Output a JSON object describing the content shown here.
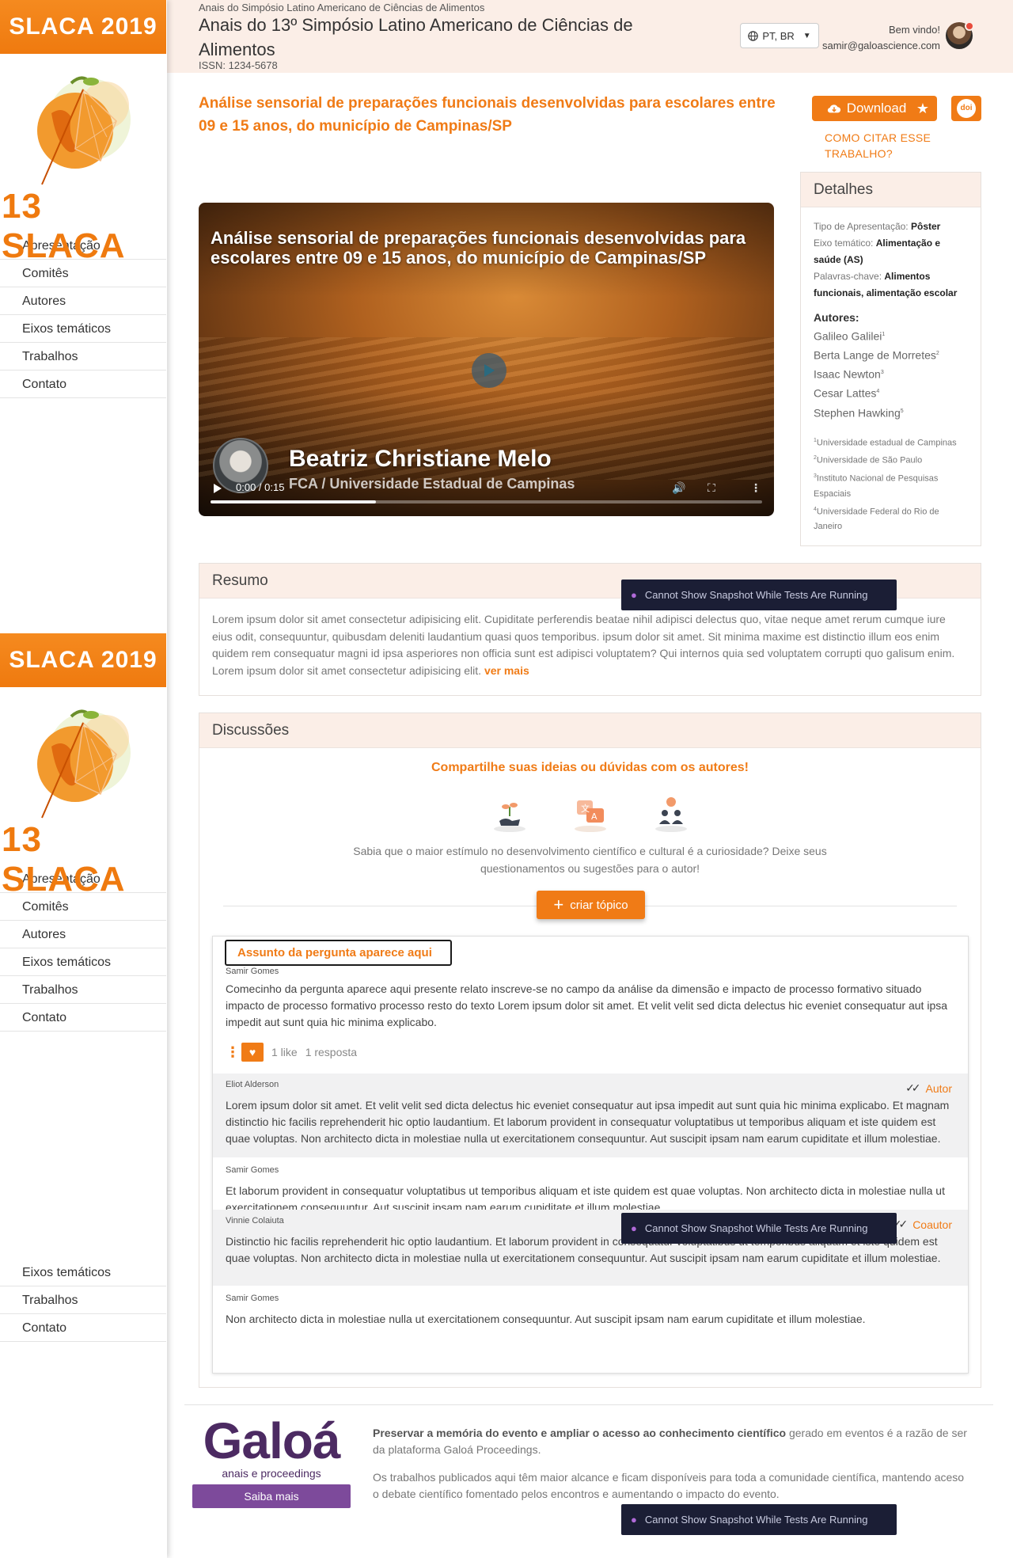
{
  "sidebar": {
    "banner": "SLACA 2019",
    "logo_text": "13 SLACA",
    "items": [
      "Apresentação",
      "Comitês",
      "Autores",
      "Eixos temáticos",
      "Trabalhos",
      "Contato"
    ],
    "partial_items": [
      "Eixos temáticos",
      "Trabalhos",
      "Contato"
    ]
  },
  "header": {
    "crumb": "Anais do Simpósio Latino Americano de Ciências de Alimentos",
    "title": "Anais do 13º Simpósio Latino Americano de Ciências de Alimentos",
    "issn": "ISSN: 1234-5678",
    "language": "PT, BR",
    "welcome": "Bem vindo!",
    "email": "samir@galoascience.com"
  },
  "paper": {
    "title": "Análise sensorial de preparações funcionais desenvolvidas para escolares entre 09 e 15 anos, do município de Campinas/SP",
    "download_label": "Download",
    "doi_label": "doi",
    "cite_label": "COMO CITAR ESSE TRABALHO?"
  },
  "details": {
    "heading": "Detalhes",
    "tipo_key": "Tipo de Apresentação: ",
    "tipo_val": "Pôster",
    "eixo_key": "Eixo temático: ",
    "eixo_val": "Alimentação e saúde (AS)",
    "palavras_key": "Palavras-chave: ",
    "palavras_val": "Alimentos funcionais, alimentação escolar",
    "authors_heading": "Autores:",
    "authors": [
      {
        "name": "Galileo Galilei",
        "sup": "1"
      },
      {
        "name": "Berta Lange de Morretes",
        "sup": "2"
      },
      {
        "name": "Isaac Newton",
        "sup": "3"
      },
      {
        "name": "Cesar Lattes",
        "sup": "4"
      },
      {
        "name": "Stephen Hawking",
        "sup": "5"
      }
    ],
    "affiliations": [
      {
        "sup": "1",
        "name": "Universidade estadual de Campinas"
      },
      {
        "sup": "2",
        "name": "Universidade de São Paulo"
      },
      {
        "sup": "3",
        "name": "Instituto Nacional de Pesquisas Espaciais"
      },
      {
        "sup": "4",
        "name": "Universidade Federal do Rio de Janeiro"
      }
    ]
  },
  "video": {
    "title": "Análise sensorial de preparações funcionais desenvolvidas para escolares entre 09 e 15 anos, do município de Campinas/SP",
    "presenter": "Beatriz Christiane Melo",
    "institution": "FCA / Universidade Estadual de Campinas",
    "time": "0:00 / 0:15",
    "progress": 0.3
  },
  "resumo": {
    "heading": "Resumo",
    "text": "Lorem ipsum dolor sit amet consectetur adipisicing elit. Cupiditate perferendis beatae nihil adipisci delectus quo, vitae neque amet rerum cumque iure eius odit, consequuntur, quibusdam deleniti laudantium quasi quos temporibus. ipsum dolor sit amet. Sit minima maxime est distinctio illum eos enim quidem rem consequatur magni id ipsa asperiores non officia sunt est adipisci voluptatem? Qui internos quia sed voluptatem corrupti quo galisum enim. Lorem ipsum dolor sit amet consectetur adipisicing elit.",
    "more": "ver mais"
  },
  "toast": "Cannot Show Snapshot While Tests Are Running",
  "discussions": {
    "heading": "Discussões",
    "share": "Compartilhe suas ideias ou dúvidas com os autores!",
    "hint": "Sabia que o maior estímulo no desenvolvimento científico e cultural é a curiosidade? Deixe seus questionamentos ou sugestões para o autor!",
    "create_label": "criar tópico",
    "thread": {
      "subject": "Assunto da pergunta aparece aqui",
      "author": "Samir Gomes",
      "body": "Comecinho da pergunta aparece aqui presente relato inscreve-se no campo da análise da dimensão e impacto de processo formativo situado impacto de processo formativo processo resto do texto Lorem ipsum dolor sit amet. Et velit velit sed dicta delectus hic eveniet consequatur aut ipsa impedit aut sunt quia hic minima explicabo.",
      "likes": "1 like",
      "replies_count": "1 resposta"
    },
    "replies": [
      {
        "author": "Eliot Alderson",
        "role": "Autor",
        "body": "Lorem ipsum dolor sit amet. Et velit velit sed dicta delectus hic eveniet consequatur aut ipsa impedit aut sunt quia hic minima explicabo. Et magnam distinctio hic facilis reprehenderit hic optio laudantium. Et laborum provident in consequatur voluptatibus ut temporibus aliquam et iste quidem est quae voluptas. Non architecto dicta in molestiae nulla ut exercitationem consequuntur. Aut suscipit ipsam nam earum cupiditate et illum molestiae."
      },
      {
        "author": "Samir Gomes",
        "role": "",
        "body": "Et laborum provident in consequatur voluptatibus ut temporibus aliquam et iste quidem est quae voluptas. Non architecto dicta in molestiae nulla ut exercitationem consequuntur. Aut suscipit ipsam nam earum cupiditate et illum molestiae."
      },
      {
        "author": "Vinnie Colaiuta",
        "role": "Coautor",
        "body": "Distinctio hic facilis reprehenderit hic optio laudantium. Et laborum provident in consequatur voluptatibus ut temporibus aliquam et iste quidem est quae voluptas. Non architecto dicta in molestiae nulla ut exercitationem consequuntur. Aut suscipit ipsam nam earum cupiditate et illum molestiae."
      },
      {
        "author": "Samir Gomes",
        "role": "",
        "body": "Non architecto dicta in molestiae nulla ut exercitationem consequuntur. Aut suscipit ipsam nam earum cupiditate et illum molestiae."
      }
    ]
  },
  "footer": {
    "logo": "Galoá",
    "logo_sub": "anais e proceedings",
    "saiba": "Saiba mais",
    "p1_bold": "Preservar a memória do evento e ampliar o acesso ao conhecimento científico",
    "p1_rest": " gerado em eventos é a razão de ser da plataforma Galoá Proceedings.",
    "p2": "Os trabalhos publicados aqui têm maior alcance e ficam disponíveis para toda a comunidade científica, mantendo aceso o debate científico fomentado pelos encontros e aumentando o impacto do evento."
  },
  "colors": {
    "accent": "#f07b16",
    "header_bg": "#fbeee7",
    "toast_bg": "#1b1e35",
    "galoa_purple": "#4c2a62"
  }
}
